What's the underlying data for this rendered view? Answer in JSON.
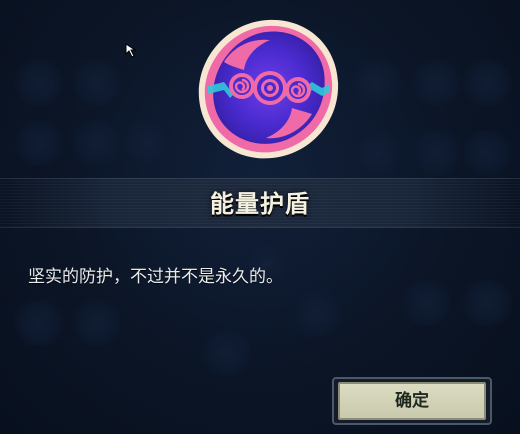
{
  "item": {
    "name": "能量护盾",
    "description": "坚实的防护，不过并不是永久的。",
    "icon": "energy-shield-swirl-badge"
  },
  "dialog": {
    "confirm_label": "确定"
  },
  "colors": {
    "background": "#0b1526",
    "title_text": "#f4f1e0",
    "button_fill": "#d4d4b9",
    "badge_pink": "#f06aa8",
    "badge_purple": "#4a2bd0",
    "badge_teal": "#2fc9d8"
  }
}
